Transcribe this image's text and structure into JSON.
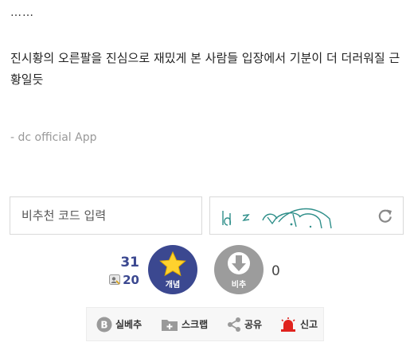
{
  "post": {
    "ellipsis": "……",
    "body": "진시황의 오른팔을 진심으로 재밌게 본 사람들 입장에서 기분이 더 더러워질 근황일듯",
    "signature": "- dc official App"
  },
  "recommend_code": {
    "placeholder": "비추천 코드 입력"
  },
  "captcha": {
    "refresh_icon": "refresh-icon"
  },
  "votes": {
    "up_count": "31",
    "fixed_count": "20",
    "up_label": "개념",
    "down_label": "비추",
    "down_count": "0",
    "up_color": "#3b4890",
    "down_color": "#9c9c9c",
    "star_color": "#ffd22e"
  },
  "actions": {
    "best": "실베추",
    "scrap": "스크랩",
    "share": "공유",
    "report": "신고"
  }
}
